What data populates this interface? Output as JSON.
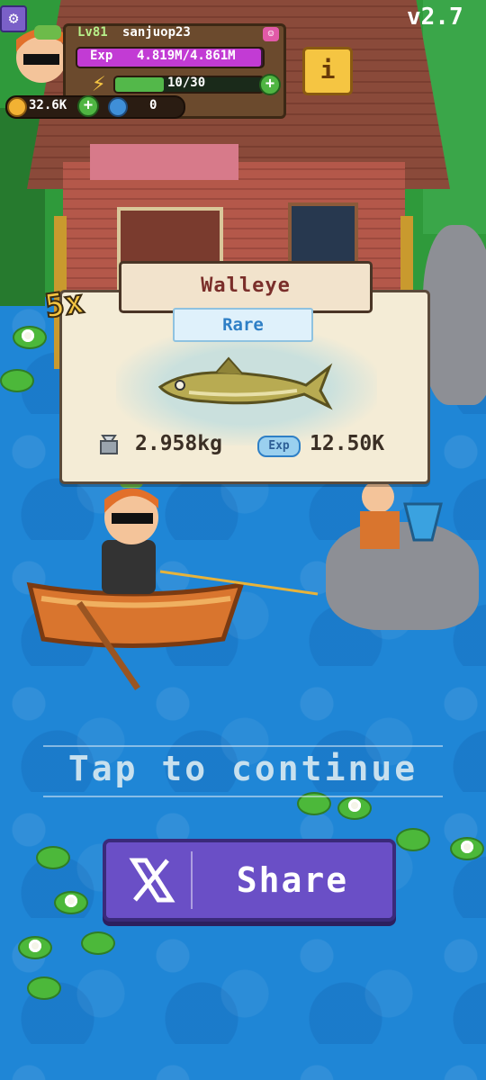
{
  "version": "v2.7",
  "player": {
    "level": "Lv81",
    "username": "sanjuop23",
    "exp_label": "Exp",
    "exp_value": "4.819M/4.861M",
    "exp_progress": 0.99,
    "energy_value": "10/30",
    "energy_progress": 0.33,
    "coins": "32.6K",
    "gems": "0"
  },
  "catch": {
    "multiplier": "5x",
    "fish_name": "Walleye",
    "rarity": "Rare",
    "weight": "2.958kg",
    "exp_badge": "Exp",
    "exp_reward": "12.50K"
  },
  "prompt": {
    "tap_to_continue": "Tap to continue"
  },
  "share": {
    "label": "Share"
  },
  "icons": {
    "settings": "gear-icon",
    "info": "info-icon",
    "chat": "chat-icon",
    "energy": "lightning-icon",
    "coin": "coin-icon",
    "gem": "globe-icon",
    "weight": "scale-icon",
    "x_logo": "x-logo-icon"
  },
  "colors": {
    "water": "#1e83d6",
    "exp_bar": "#c23bd4",
    "energy_bar": "#53b84a",
    "rarity_text": "#2e7fc6",
    "share_button": "#6a4fc6",
    "fish_name": "#7a2e2a"
  }
}
